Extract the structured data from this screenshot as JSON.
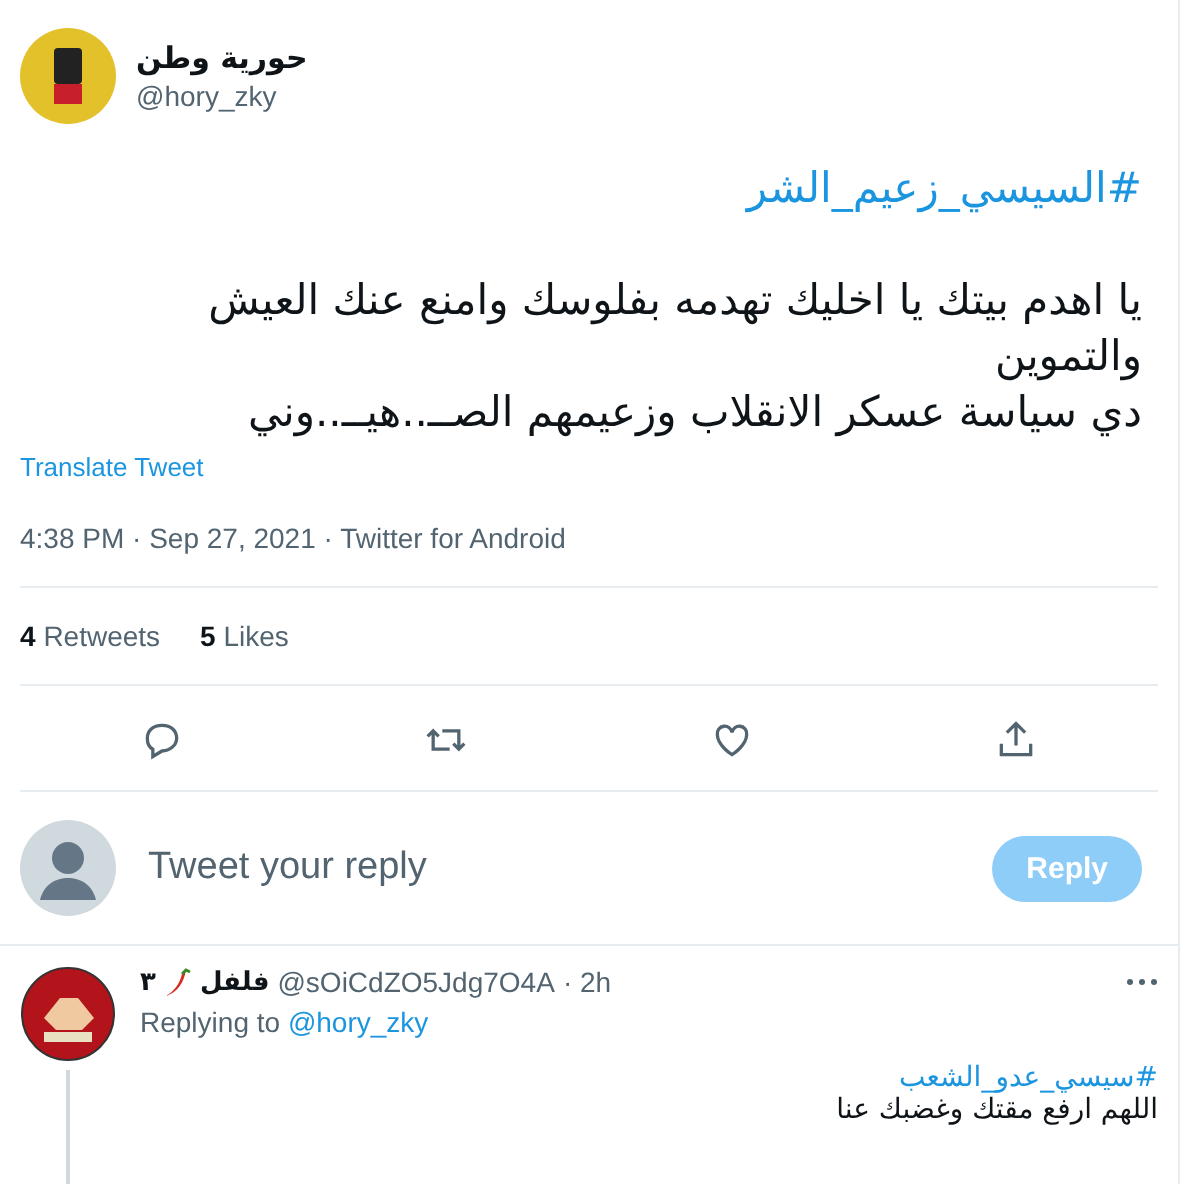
{
  "tweet": {
    "display_name": "حورية وطن",
    "handle": "@hory_zky",
    "hashtag": "#السيسي_زعيم_الشر",
    "body_lines": [
      "يا اهدم بيتك يا اخليك تهدمه بفلوسك وامنع عنك العيش",
      "والتموين",
      "دي سياسة عسكر الانقلاب وزعيمهم الصــ..هيــ..وني"
    ],
    "translate": "Translate Tweet",
    "meta": "4:38 PM · Sep 27, 2021 · Twitter for Android",
    "retweets": {
      "count": "4",
      "label": "Retweets"
    },
    "likes": {
      "count": "5",
      "label": "Likes"
    }
  },
  "compose": {
    "placeholder": "Tweet your reply",
    "button": "Reply",
    "disabled": true
  },
  "reply": {
    "name": "فلفل",
    "name_suffix": "٣",
    "handle": "@sOiCdZO5Jdg7O4A",
    "time": "· 2h",
    "replying_label": "Replying to",
    "replying_to": "@hory_zky",
    "hashtag": "#سيسي_عدو_الشعب",
    "text": "اللهم ارفع مقتك وغضبك عنا"
  }
}
